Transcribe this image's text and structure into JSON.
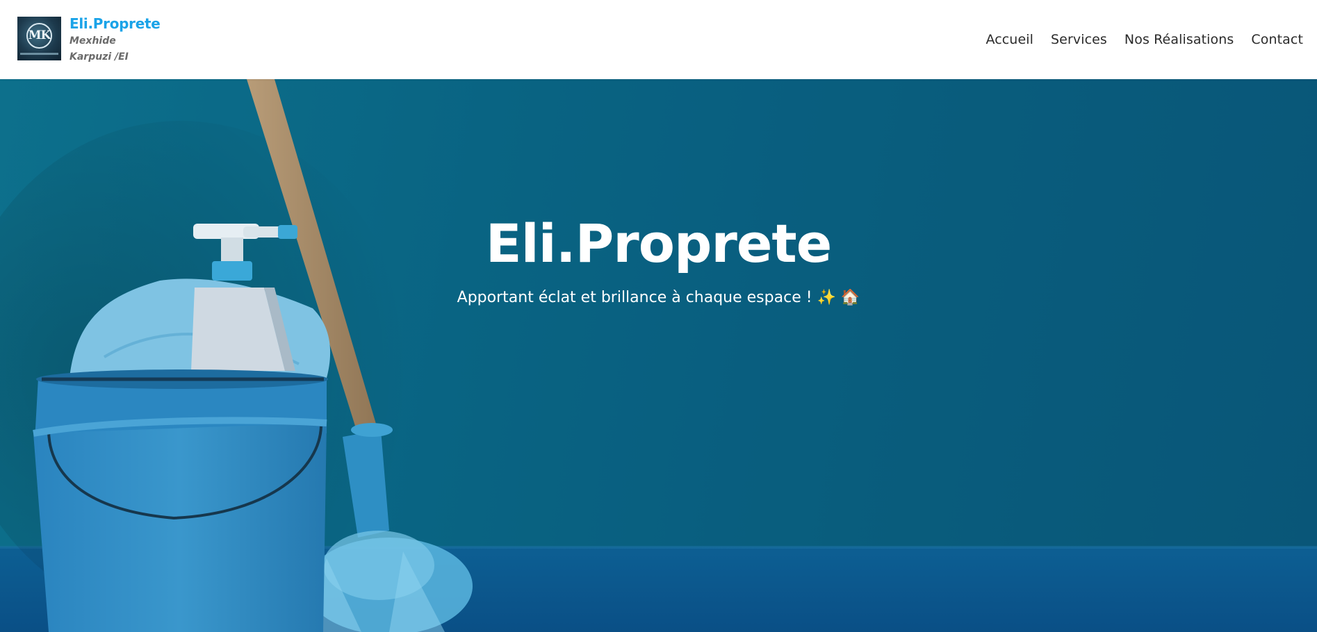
{
  "brand": {
    "name": "Eli.Proprete",
    "subtitle": "Mexhide Karpuzi /EI",
    "logo_text": "MK"
  },
  "nav": {
    "items": [
      {
        "label": "Accueil"
      },
      {
        "label": "Services"
      },
      {
        "label": "Nos Réalisations"
      },
      {
        "label": "Contact"
      }
    ]
  },
  "hero": {
    "title": "Eli.Proprete",
    "subtitle": "Apportant éclat et brillance à chaque espace ! ✨ 🏠"
  },
  "colors": {
    "brand_accent": "#1aa3e8",
    "hero_background": "#0a6d8f",
    "nav_text": "#2b2b2b"
  }
}
